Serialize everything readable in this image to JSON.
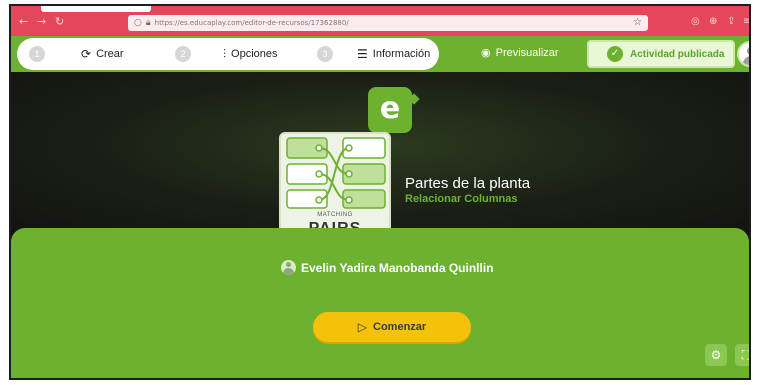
{
  "browser": {
    "url": "https://es.educaplay.com/editor-de-recursos/17362880/",
    "back_icon": "arrow-left-icon",
    "forward_icon": "arrow-right-icon",
    "reload_icon": "reload-icon",
    "bookmark_icon": "star-icon",
    "accent": "#e6465a"
  },
  "header": {
    "steps": [
      {
        "num": "1",
        "label": "Crear",
        "icon": "puzzle-icon"
      },
      {
        "num": "2",
        "label": "Opciones",
        "icon": "sliders-icon"
      },
      {
        "num": "3",
        "label": "Información",
        "icon": "list-icon"
      }
    ],
    "preview_label": "Previsualizar",
    "published_label": "Actividad publicada",
    "brand_green": "#6cb22f"
  },
  "hero": {
    "logo_letter": "e",
    "card_caption": "MATCHING",
    "card_big": "PAIRS",
    "title": "Partes de la planta",
    "subtitle": "Relacionar Columnas"
  },
  "panel": {
    "author": "Evelin Yadira Manobanda Quinllin",
    "start_label": "Comenzar",
    "button_color": "#f5c20b"
  }
}
